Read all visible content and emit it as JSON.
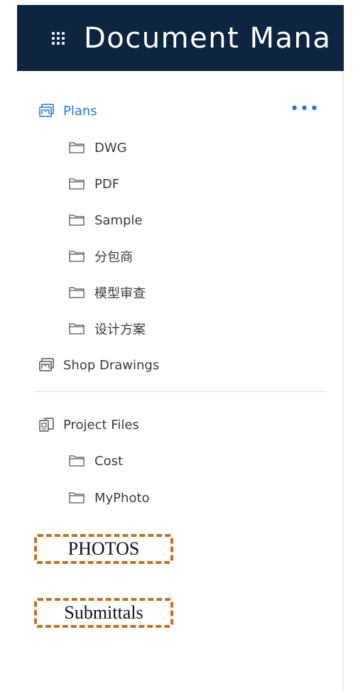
{
  "header": {
    "title": "Document Mana",
    "menu_icon": "grid-icon"
  },
  "tree": {
    "plans": {
      "label": "Plans",
      "icon": "plans-icon",
      "more": "•••",
      "children": [
        {
          "label": "DWG"
        },
        {
          "label": "PDF"
        },
        {
          "label": "Sample"
        },
        {
          "label": "分包商"
        },
        {
          "label": "模型审查"
        },
        {
          "label": "设计方案"
        }
      ]
    },
    "shop_drawings": {
      "label": "Shop Drawings",
      "icon": "shop-drawings-icon"
    },
    "project_files": {
      "label": "Project Files",
      "icon": "project-files-icon",
      "children": [
        {
          "label": "Cost"
        },
        {
          "label": "MyPhoto"
        }
      ]
    }
  },
  "annotations": {
    "photos": "PHOTOS",
    "submittals": "Submittals"
  },
  "colors": {
    "header_bg": "#0e2540",
    "accent": "#1f7ad9",
    "annotation_border": "#c76f1c"
  }
}
